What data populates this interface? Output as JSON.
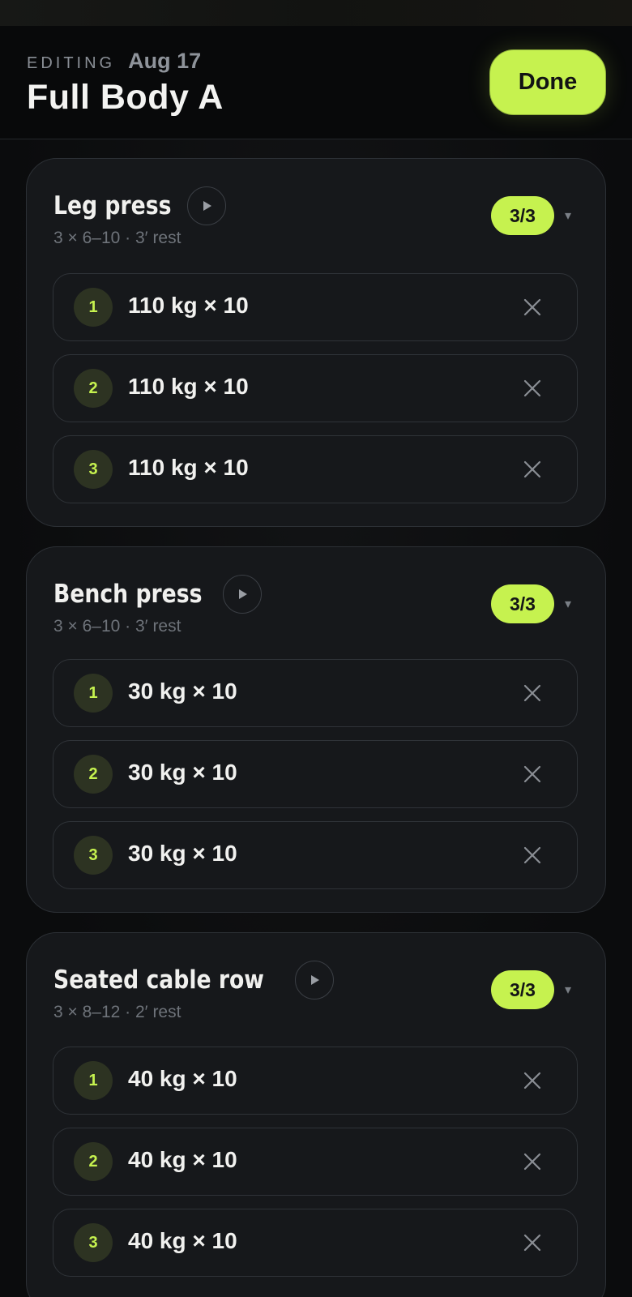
{
  "header": {
    "editing_label": "EDITING",
    "date": "Aug 17",
    "title": "Full Body A",
    "done_label": "Done"
  },
  "colors": {
    "accent": "#c6f24f",
    "background": "#0c0d0e",
    "card": "#16181b"
  },
  "exercises": [
    {
      "name": "Leg press",
      "meta": "3 × 6–10 · 3′ rest",
      "progress": "3/3",
      "sets": [
        {
          "num": "1",
          "text": "110 kg × 10"
        },
        {
          "num": "2",
          "text": "110 kg × 10"
        },
        {
          "num": "3",
          "text": "110 kg × 10"
        }
      ]
    },
    {
      "name": "Bench press",
      "meta": "3 × 6–10 · 3′ rest",
      "progress": "3/3",
      "sets": [
        {
          "num": "1",
          "text": "30 kg × 10"
        },
        {
          "num": "2",
          "text": "30 kg × 10"
        },
        {
          "num": "3",
          "text": "30 kg × 10"
        }
      ]
    },
    {
      "name": "Seated cable row",
      "meta": "3 × 8–12 · 2′ rest",
      "progress": "3/3",
      "sets": [
        {
          "num": "1",
          "text": "40 kg × 10"
        },
        {
          "num": "2",
          "text": "40 kg × 10"
        },
        {
          "num": "3",
          "text": "40 kg × 10"
        }
      ]
    }
  ],
  "icons": {
    "play": "play-icon",
    "remove": "close-icon",
    "expand": "caret-down-icon"
  },
  "caret_glyph": "▾"
}
